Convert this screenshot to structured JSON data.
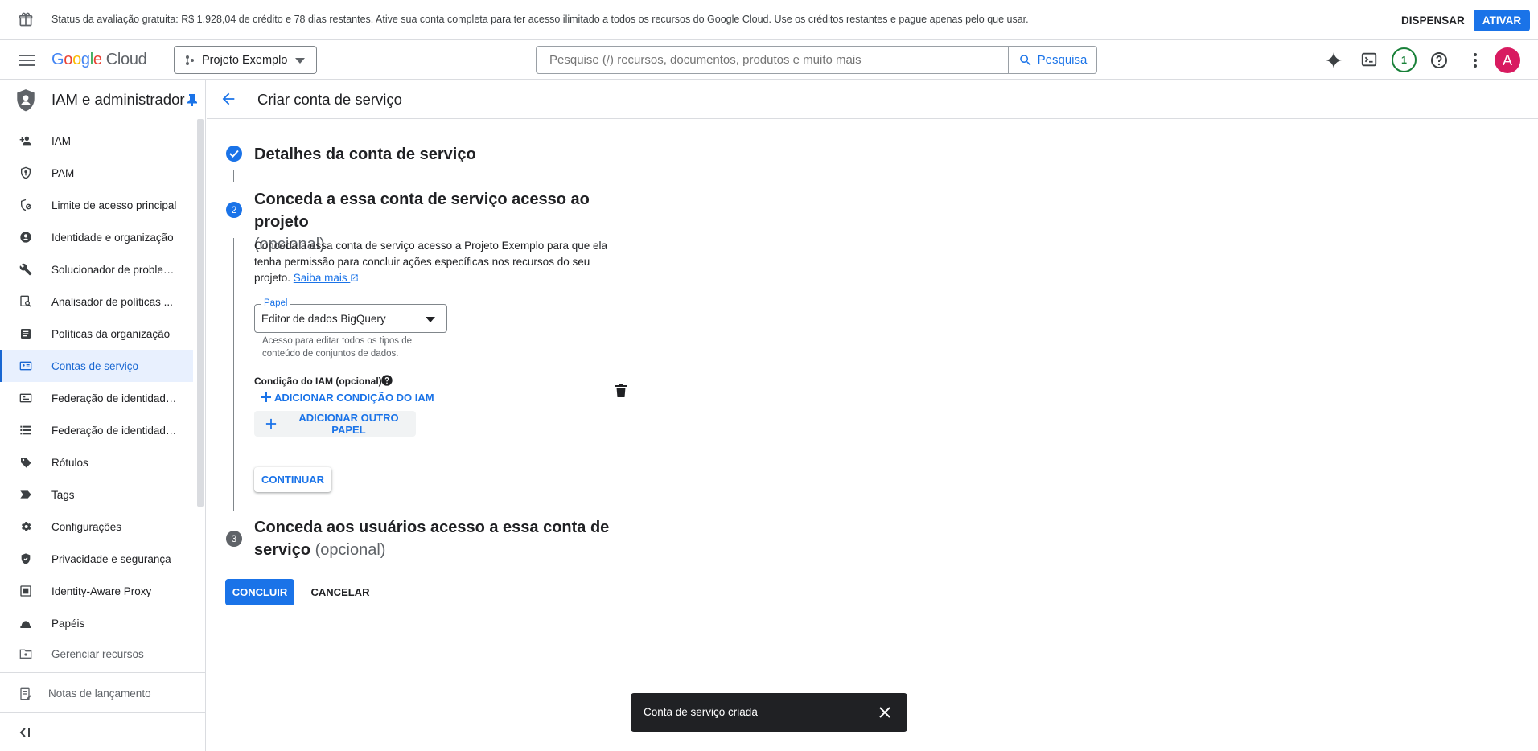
{
  "trial_banner": {
    "message": "Status da avaliação gratuita: R$ 1.928,04 de crédito e 78 dias restantes. Ative sua conta completa para ter acesso ilimitado a todos os recursos do Google Cloud. Use os créditos restantes e pague apenas pelo que usar.",
    "dismiss_label": "DISPENSAR",
    "activate_label": "ATIVAR",
    "icon": "gift-icon"
  },
  "topbar": {
    "logo_google": [
      "G",
      "o",
      "o",
      "g",
      "l",
      "e"
    ],
    "logo_cloud": "Cloud",
    "project_label": "Projeto Exemplo",
    "search_placeholder": "Pesquise (/) recursos, documentos, produtos e muito mais",
    "search_button": "Pesquisa",
    "notifications_count": "1",
    "avatar_letter": "A",
    "icons": [
      "menu-icon",
      "gemini-icon",
      "cloud-shell-icon",
      "help-icon",
      "more-vert-icon"
    ]
  },
  "sidebar": {
    "title": "IAM e administrador",
    "items": [
      {
        "label": "IAM",
        "icon": "person-add-icon",
        "active": false
      },
      {
        "label": "PAM",
        "icon": "shield-key-icon",
        "active": false
      },
      {
        "label": "Limite de acesso principal",
        "icon": "boundary-icon",
        "active": false
      },
      {
        "label": "Identidade e organização",
        "icon": "account-circle-icon",
        "active": false
      },
      {
        "label": "Solucionador de problem...",
        "icon": "wrench-icon",
        "active": false
      },
      {
        "label": "Analisador de políticas ...",
        "icon": "policy-search-icon",
        "active": false
      },
      {
        "label": "Políticas da organização",
        "icon": "article-icon",
        "active": false
      },
      {
        "label": "Contas de serviço",
        "icon": "service-account-icon",
        "active": true
      },
      {
        "label": "Federação de identidade ...",
        "icon": "id-card-icon",
        "active": false
      },
      {
        "label": "Federação de identidade ...",
        "icon": "list-icon",
        "active": false
      },
      {
        "label": "Rótulos",
        "icon": "label-icon",
        "active": false
      },
      {
        "label": "Tags",
        "icon": "tag-arrow-icon",
        "active": false
      },
      {
        "label": "Configurações",
        "icon": "settings-icon",
        "active": false
      },
      {
        "label": "Privacidade e segurança",
        "icon": "privacy-shield-icon",
        "active": false
      },
      {
        "label": "Identity-Aware Proxy",
        "icon": "proxy-icon",
        "active": false
      },
      {
        "label": "Papéis",
        "icon": "hat-icon",
        "active": false
      }
    ],
    "manage_resources": "Gerenciar recursos",
    "release_notes": "Notas de lançamento"
  },
  "main": {
    "title": "Criar conta de serviço",
    "step1": {
      "title": "Detalhes da conta de serviço"
    },
    "step2": {
      "number": "2",
      "title": "Conceda a essa conta de serviço acesso ao projeto",
      "optional": "(opcional)",
      "description": "Conceda a essa conta de serviço acesso a Projeto Exemplo para que ela tenha permissão para concluir ações específicas nos recursos do seu projeto.",
      "learn_more": "Saiba mais",
      "role_legend": "Papel",
      "role_value": "Editor de dados BigQuery",
      "role_hint": "Acesso para editar todos os tipos de conteúdo de conjuntos de dados.",
      "condition_label": "Condição do IAM (opcional)",
      "add_condition": "ADICIONAR CONDIÇÃO DO IAM",
      "add_role": "ADICIONAR OUTRO PAPEL",
      "continue": "CONTINUAR"
    },
    "step3": {
      "number": "3",
      "title_line1": "Conceda aos usuários acesso a essa conta de",
      "title_line2": "serviço",
      "optional": "(opcional)"
    },
    "done": "CONCLUIR",
    "cancel": "CANCELAR"
  },
  "toast": {
    "message": "Conta de serviço criada"
  },
  "colors": {
    "accent": "#1a73e8",
    "active_bg": "#e8f0fe",
    "notif": "#188038",
    "avatar": "#d81b60"
  }
}
